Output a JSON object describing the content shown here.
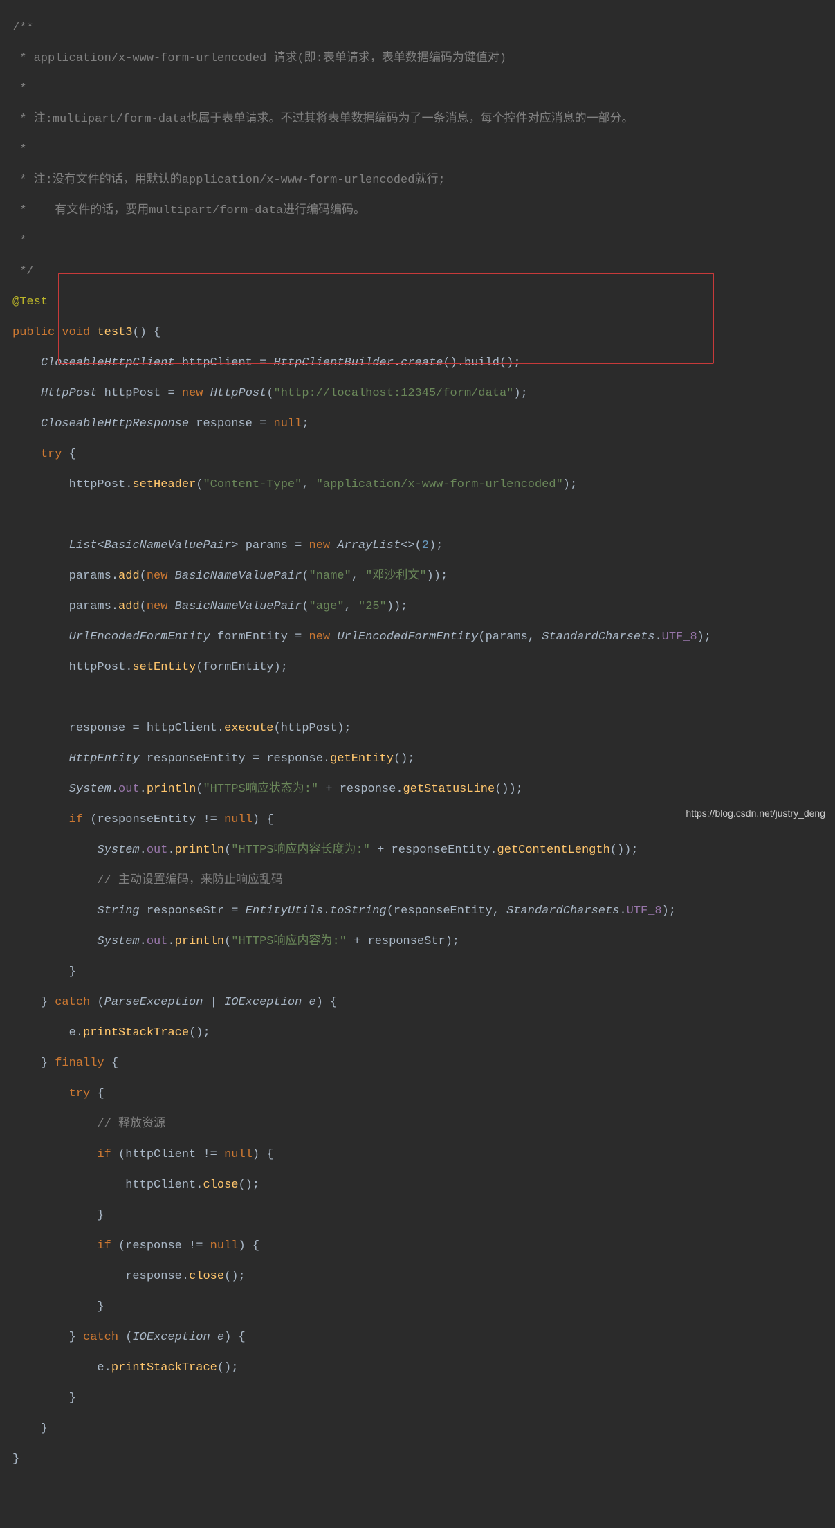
{
  "comment": [
    "/**",
    " * application/x-www-form-urlencoded 请求(即:表单请求，表单数据编码为键值对)",
    " *",
    " * 注:multipart/form-data也属于表单请求。不过其将表单数据编码为了一条消息，每个控件对应消息的一部分。",
    " *",
    " * 注:没有文件的话，用默认的application/x-www-form-urlencoded就行;",
    " *    有文件的话，要用multipart/form-data进行编码编码。",
    " *",
    " */"
  ],
  "annot": "@Test",
  "kw": {
    "public": "public",
    "void": "void",
    "new": "new",
    "null": "null",
    "try": "try",
    "if": "if",
    "catch": "catch",
    "finally": "finally"
  },
  "id": {
    "test3": "test3",
    "httpClient": "httpClient",
    "create": "create",
    "build": "build",
    "httpPost": "httpPost",
    "response": "response",
    "setHeader": "setHeader",
    "params": "params",
    "add": "add",
    "formEntity": "formEntity",
    "setEntity": "setEntity",
    "execute": "execute",
    "responseEntity": "responseEntity",
    "getEntity": "getEntity",
    "println": "println",
    "getStatusLine": "getStatusLine",
    "getContentLength": "getContentLength",
    "responseStr": "responseStr",
    "toString": "toString",
    "printStackTrace": "printStackTrace",
    "close": "close",
    "e": "e",
    "out": "out"
  },
  "type": {
    "CloseableHttpClient": "CloseableHttpClient",
    "HttpClientBuilder": "HttpClientBuilder",
    "HttpPost": "HttpPost",
    "CloseableHttpResponse": "CloseableHttpResponse",
    "List": "List",
    "BasicNameValuePair": "BasicNameValuePair",
    "ArrayList": "ArrayList",
    "UrlEncodedFormEntity": "UrlEncodedFormEntity",
    "StandardCharsets": "StandardCharsets",
    "HttpEntity": "HttpEntity",
    "System": "System",
    "String": "String",
    "EntityUtils": "EntityUtils",
    "ParseException": "ParseException",
    "IOException": "IOException"
  },
  "field": {
    "UTF_8": "UTF_8"
  },
  "str": {
    "url": "\"http://localhost:12345/form/data\"",
    "hdrName": "\"Content-Type\"",
    "hdrVal": "\"application/x-www-form-urlencoded\"",
    "pName": "\"name\"",
    "pNameVal": "\"邓沙利文\"",
    "pAge": "\"age\"",
    "pAgeVal": "\"25\"",
    "s1": "\"HTTPS响应状态为:\"",
    "s2": "\"HTTPS响应内容长度为:\"",
    "s3": "\"HTTPS响应内容为:\""
  },
  "num": {
    "two": "2"
  },
  "inlineComment": {
    "c1": "// 主动设置编码，来防止响应乱码",
    "c2": "// 释放资源"
  },
  "watermark": "https://blog.csdn.net/justry_deng"
}
